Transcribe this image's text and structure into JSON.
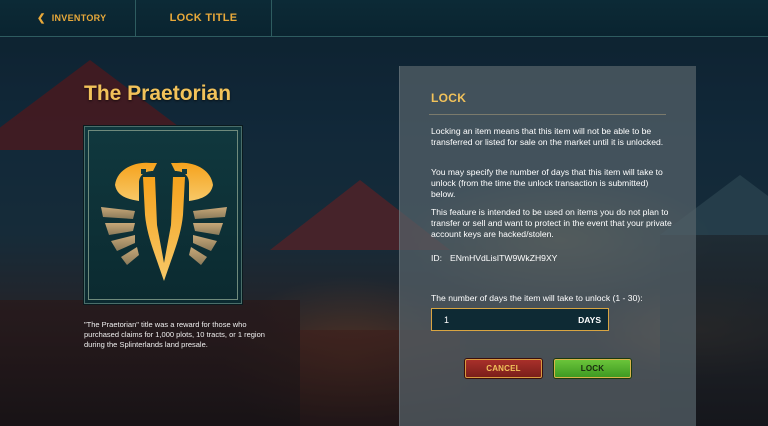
{
  "nav": {
    "back_label": "INVENTORY",
    "back_icon": "chevron-left-icon",
    "page_title": "LOCK TITLE"
  },
  "item": {
    "name": "The Praetorian",
    "emblem_icon": "praetorian-eagle-emblem-icon",
    "description": "\"The Praetorian\" title was a reward for those who purchased claims for 1,000 plots, 10 tracts, or 1 region during the Splinterlands land presale."
  },
  "lock_panel": {
    "title": "LOCK",
    "paragraphs": [
      "Locking an item means that this item will not be able to be transferred or listed for sale on the market until it is unlocked.",
      "You may specify the number of days that this item will take to unlock (from the time the unlock transaction is submitted) below.",
      "This feature is intended to be used on items you do not plan to transfer or sell and want to protect in the event that your private account keys are hacked/stolen."
    ],
    "id_label": "ID:",
    "id_value": "ENmHVdLisITW9WkZH9XY",
    "days_label": "The number of days the item will take to unlock (1 - 30):",
    "days_value": "1",
    "days_unit": "DAYS",
    "cancel_label": "CANCEL",
    "lock_label": "LOCK"
  },
  "colors": {
    "accent_gold": "#f2c25a",
    "cancel_red": "#a8302a",
    "lock_green": "#6ac43a"
  }
}
